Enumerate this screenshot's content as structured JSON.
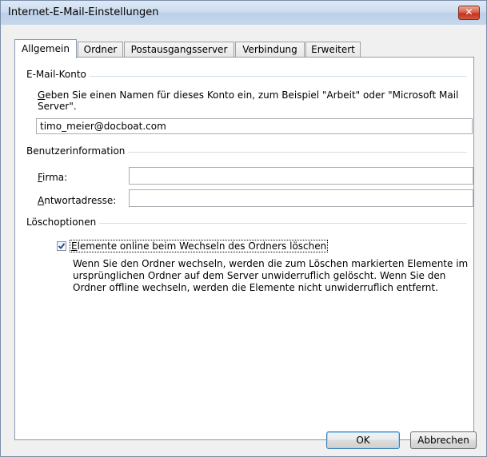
{
  "window": {
    "title": "Internet-E-Mail-Einstellungen",
    "close_symbol": "✕"
  },
  "tabs": [
    {
      "label": "Allgemein",
      "active": true
    },
    {
      "label": "Ordner"
    },
    {
      "label": "Postausgangsserver"
    },
    {
      "label": "Verbindung"
    },
    {
      "label": "Erweitert"
    }
  ],
  "email_account": {
    "group_title": "E-Mail-Konto",
    "desc_accel": "G",
    "desc_rest_line1": "eben Sie einen Namen für dieses Konto ein, zum Beispiel \"Arbeit\" oder \"Microsoft Mail",
    "desc_line2": "Server\".",
    "account_name_value": "timo_meier@docboat.com"
  },
  "user_info": {
    "group_title": "Benutzerinformation",
    "company_accel": "F",
    "company_rest": "irma:",
    "company_value": "",
    "reply_accel": "A",
    "reply_rest": "ntwortadresse:",
    "reply_value": ""
  },
  "delete_options": {
    "group_title": "Löschoptionen",
    "checkbox_checked": true,
    "checkbox_accel": "E",
    "checkbox_rest": "lemente online beim Wechseln des Ordners löschen",
    "explanation_lines": [
      "Wenn Sie den Ordner wechseln, werden die zum Löschen markierten Elemente im",
      "ursprünglichen Ordner auf dem Server unwiderruflich gelöscht. Wenn Sie den",
      "Ordner offline wechseln, werden die Elemente nicht unwiderruflich entfernt."
    ]
  },
  "buttons": {
    "ok": "OK",
    "cancel": "Abbrechen"
  }
}
